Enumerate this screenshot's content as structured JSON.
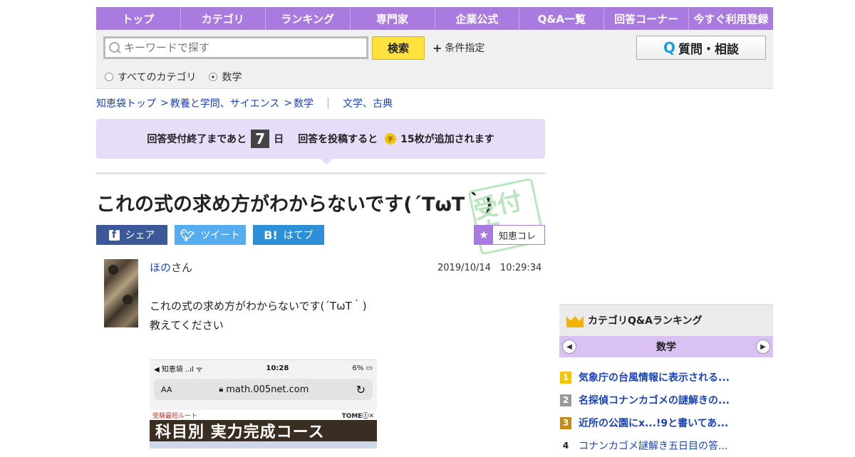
{
  "nav": {
    "items": [
      "トップ",
      "カテゴリ",
      "ランキング",
      "専門家",
      "企業公式",
      "Q&A一覧",
      "回答コーナー",
      "今すぐ利用登録"
    ]
  },
  "search": {
    "placeholder": "キーワードで探す",
    "button_label": "検索",
    "conditions_label": "条件指定",
    "ask_button_label": "質問・相談",
    "ask_button_icon": "Q",
    "radios": [
      {
        "label": "すべてのカテゴリ",
        "selected": false
      },
      {
        "label": "数学",
        "selected": true
      }
    ]
  },
  "breadcrumb": {
    "items": [
      "知恵袋トップ",
      "教養と学問、サイエンス",
      "数学"
    ],
    "related": "文学、古典"
  },
  "notice": {
    "prefix": "回答受付終了まであと",
    "days": "7",
    "day_unit": "日",
    "post_text": "回答を投稿すると",
    "coin_label": "チ",
    "reward_text": "15枚が追加されます"
  },
  "question": {
    "title": "これの式の求め方がわからないです(´TωT｀)",
    "stamp_text": "受付中",
    "user_name": "ほの",
    "user_suffix": "さん",
    "date": "2019/10/14　10:29:34",
    "body_lines": [
      "これの式の求め方がわからないです(´TωT｀)",
      "教えてください"
    ]
  },
  "share": {
    "facebook": "シェア",
    "facebook_icon": "f",
    "twitter": "ツイート",
    "hatena": "はてブ",
    "hatena_icon": "B!",
    "chiekore": "知恵コレ"
  },
  "screenshot": {
    "status_left": "◀ 知恵袋 ..ıl ᯤ",
    "time": "10:28",
    "battery": "6% ▭",
    "aa": "AA",
    "url": "math.005net.com",
    "ad_tag": "受験最短ルート",
    "ad_brand": "TOMEⓘ✕",
    "ad_banner": "科目別 実力完成コース"
  },
  "ranking": {
    "title": "カテゴリQ&Aランキング",
    "category": "数学",
    "items": [
      {
        "rank": "1",
        "text": "気象庁の台風情報に表示される..."
      },
      {
        "rank": "2",
        "text": "名探偵コナンカゴメの謎解きの..."
      },
      {
        "rank": "3",
        "text": "近所の公園にx...!9と書いてあ..."
      },
      {
        "rank": "4",
        "text": "コナンカゴメ謎解き五日目の答..."
      }
    ]
  },
  "colors": {
    "accent": "#a97be0",
    "notice_bg": "#e8ddf8",
    "link": "#1a44b8",
    "search_button": "#ffe23d"
  }
}
